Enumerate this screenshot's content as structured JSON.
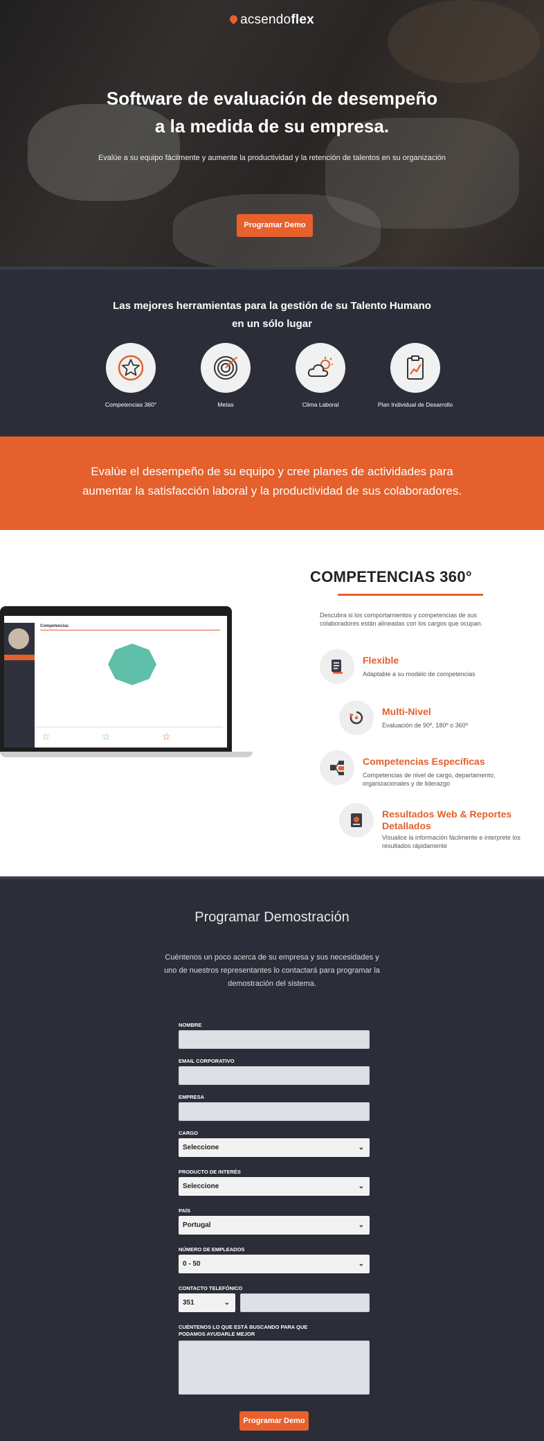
{
  "brand": {
    "name_prefix": "acsendo",
    "name_suffix": "flex",
    "accent": "#e8612d"
  },
  "hero": {
    "title_line1": "Software de evaluación de desempeño",
    "title_line2": "a la medida de su empresa.",
    "subtitle": "Evalúe a su equipo fácilmente y aumente la productividad y la retención de talentos en su organización",
    "cta": "Programar Demo"
  },
  "tools": {
    "heading_line1": "Las mejores herramientas para la gestión de su Talento Humano",
    "heading_line2": "en un sólo lugar",
    "items": [
      {
        "label": "Competencias 360°",
        "icon": "star-icon"
      },
      {
        "label": "Metas",
        "icon": "target-icon"
      },
      {
        "label": "Clima Laboral",
        "icon": "cloud-sun-icon"
      },
      {
        "label": "Plan Individual de Desarrollo",
        "icon": "clipboard-chart-icon"
      }
    ]
  },
  "band": {
    "line1": "Evalúe el desempeño de su equipo y cree planes de actividades para",
    "line2": "aumentar la satisfacción laboral y la productividad de sus colaboradores."
  },
  "competencias": {
    "title": "COMPETENCIAS 360°",
    "description": "Descubra si los comportamientos y competencias de sus colaboradores están alineadas con los cargos que ocupan.",
    "screen_tab": "Competencias",
    "features": [
      {
        "title": "Flexible",
        "desc": "Adaptable a su modelo de competencias"
      },
      {
        "title": "Multi-Nivel",
        "desc": "Evaluación de 90º, 180º o 360º"
      },
      {
        "title": "Competencias Específicas",
        "desc": "Competencias de nivel de cargo, departamento, organizacionales y de liderazgo"
      },
      {
        "title": "Resultados Web & Reportes Detallados",
        "desc": "Visualice la información fácilmente e interprete los resultados rápidamente"
      }
    ]
  },
  "form": {
    "title": "Programar Demostración",
    "intro": "Cuéntenos un poco acerca de su empresa y sus necesidades y uno de nuestros representantes lo contactará para programar la demostración del sistema.",
    "labels": {
      "nombre": "NOMBRE",
      "email": "EMAIL CORPORATIVO",
      "empresa": "EMPRESA",
      "cargo": "CARGO",
      "producto": "PRODUCTO DE INTERÉS",
      "pais": "PAÍS",
      "empleados": "NÚMERO DE EMPLEADOS",
      "telefono": "CONTACTO TELEFÓNICO",
      "mensaje": "CUÉNTENOS LO QUE ESTÁ BUSCANDO PARA QUE PODAMOS AYUDARLE MEJOR"
    },
    "selects": {
      "cargo": "Seleccione",
      "producto": "Seleccione",
      "pais": "Portugal",
      "empleados": "0 - 50",
      "prefijo": "351"
    },
    "submit": "Programar Demo"
  }
}
